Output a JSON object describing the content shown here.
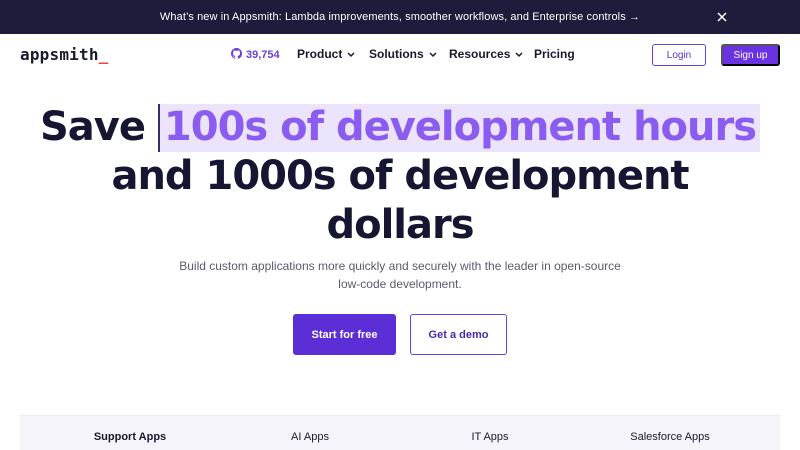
{
  "banner": {
    "text": "What’s new in Appsmith: Lambda improvements, smoother workflows, and Enterprise controls →",
    "close_icon": "close-icon"
  },
  "nav": {
    "logo": "appsmith",
    "logo_cursor": "_",
    "github_icon": "github-icon",
    "github_stars": "39,754",
    "items": [
      {
        "label": "Product"
      },
      {
        "label": "Solutions"
      },
      {
        "label": "Resources"
      },
      {
        "label": "Pricing"
      }
    ],
    "login_label": "Login",
    "signup_label": "Sign up"
  },
  "hero": {
    "line1_prefix": "Save",
    "line1_highlight": "100s of development hours",
    "line2": "and 1000s of development",
    "line3": "dollars",
    "subtext": "Build custom applications more quickly and securely with the leader in open-source low-code development.",
    "primary_cta": "Start for free",
    "secondary_cta": "Get a demo"
  },
  "tabs": [
    {
      "label": "Support Apps",
      "active": true
    },
    {
      "label": "AI Apps",
      "active": false
    },
    {
      "label": "IT Apps",
      "active": false
    },
    {
      "label": "Salesforce Apps",
      "active": false
    }
  ],
  "colors": {
    "banner_bg": "#1f1b3a",
    "brand_purple": "#6a32e0",
    "highlight_bg": "#ece4fd",
    "highlight_text": "#8b5cf0"
  }
}
